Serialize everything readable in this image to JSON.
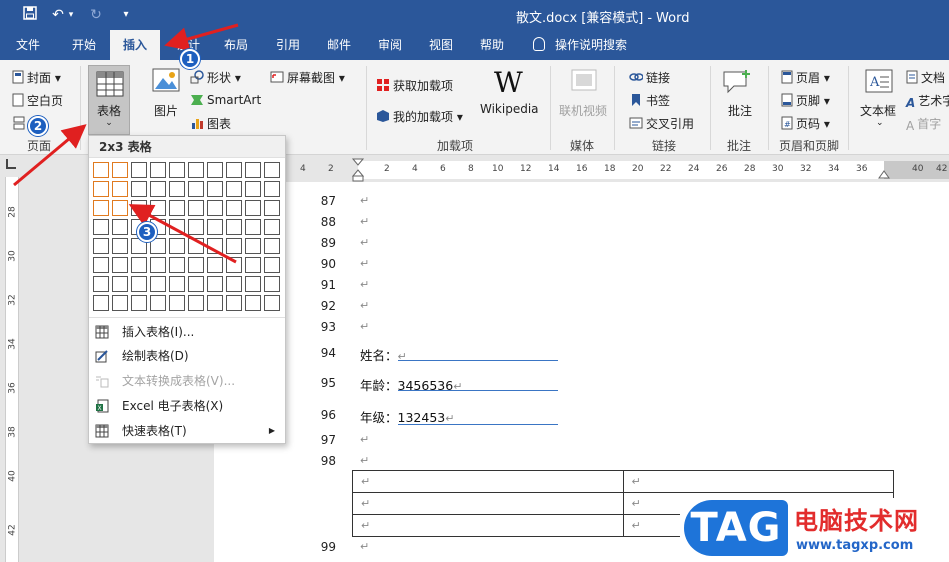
{
  "window": {
    "file_name": "散文.docx",
    "mode": "[兼容模式]",
    "separator": "-",
    "app": "Word"
  },
  "tabs": [
    "文件",
    "开始",
    "插入",
    "设计",
    "布局",
    "引用",
    "邮件",
    "审阅",
    "视图",
    "帮助"
  ],
  "tell_me": "操作说明搜索",
  "ribbon": {
    "pages": {
      "cover": "封面",
      "blank": "空白页",
      "break": "分页",
      "group": "页面"
    },
    "table": {
      "label": "表格"
    },
    "illustrations": {
      "picture": "图片",
      "shapes": "形状",
      "smartart": "SmartArt",
      "chart": "图表",
      "screenshot": "屏幕截图"
    },
    "addins": {
      "get": "获取加载项",
      "my": "我的加载项",
      "wiki_logo": "W",
      "wiki": "Wikipedia",
      "group": "加载项"
    },
    "media": {
      "video": "联机视频",
      "group": "媒体"
    },
    "links": {
      "link": "链接",
      "bookmark": "书签",
      "crossref": "交叉引用",
      "group": "链接"
    },
    "comments": {
      "comment": "批注",
      "group": "批注"
    },
    "header_footer": {
      "header": "页眉",
      "footer": "页脚",
      "page_number": "页码",
      "group": "页眉和页脚"
    },
    "text": {
      "textbox": "文本框",
      "docparts": "文档",
      "wordart": "艺术字",
      "dropcap": "首字"
    }
  },
  "table_dropdown": {
    "grid_title": "2x3 表格",
    "items": [
      {
        "label": "插入表格(I)...",
        "enabled": true
      },
      {
        "label": "绘制表格(D)",
        "enabled": true
      },
      {
        "label": "文本转换成表格(V)...",
        "enabled": false
      },
      {
        "label": "Excel 电子表格(X)",
        "enabled": true
      },
      {
        "label": "快速表格(T)",
        "enabled": true
      }
    ]
  },
  "hruler_nums": [
    "4",
    "2",
    "2",
    "4",
    "6",
    "8",
    "10",
    "12",
    "14",
    "16",
    "18",
    "20",
    "22",
    "24",
    "26",
    "28",
    "30",
    "32",
    "34",
    "36",
    "40",
    "42"
  ],
  "vruler_nums": [
    "28",
    "30",
    "32",
    "34",
    "36",
    "38",
    "40",
    "42"
  ],
  "document": {
    "lines": [
      "87",
      "88",
      "89",
      "90",
      "91",
      "92",
      "93",
      "94",
      "95",
      "96",
      "97",
      "98",
      "99"
    ],
    "para_mark": "↵",
    "fields": [
      {
        "label": "姓名：",
        "value": ""
      },
      {
        "label": "年龄：",
        "value": "3456536"
      },
      {
        "label": "年级：",
        "value": "132453"
      }
    ]
  },
  "annotations": [
    "1",
    "2",
    "3"
  ],
  "watermark": {
    "logo": "TAG",
    "name": "电脑技术网",
    "url": "www.tagxp.com"
  },
  "colors": {
    "accent": "#2b579a",
    "highlight": "#e07a1f",
    "arrow": "#e02020",
    "badge": "#1d5fbf"
  }
}
